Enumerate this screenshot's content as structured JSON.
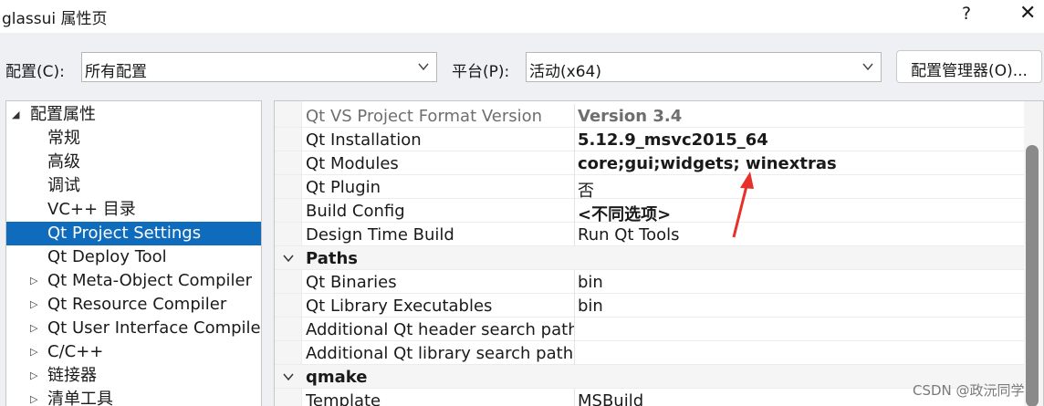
{
  "window": {
    "title": "glassui 属性页",
    "help_label": "?",
    "close_label": "✕"
  },
  "config_bar": {
    "config_label": "配置(C):",
    "config_value": "所有配置",
    "platform_label": "平台(P):",
    "platform_value": "活动(x64)",
    "manager_button": "配置管理器(O)..."
  },
  "tree": {
    "items": [
      {
        "label": "配置属性",
        "twisty": "◢"
      },
      {
        "label": "常规"
      },
      {
        "label": "高级"
      },
      {
        "label": "调试"
      },
      {
        "label": "VC++ 目录"
      },
      {
        "label": "Qt Project Settings"
      },
      {
        "label": "Qt Deploy Tool"
      },
      {
        "label": "Qt Meta-Object Compiler",
        "twisty": "▷"
      },
      {
        "label": "Qt Resource Compiler",
        "twisty": "▷"
      },
      {
        "label": "Qt User Interface Compiler",
        "twisty": "▷"
      },
      {
        "label": "C/C++",
        "twisty": "▷"
      },
      {
        "label": "链接器",
        "twisty": "▷"
      },
      {
        "label": "清单工具",
        "twisty": "▷"
      }
    ],
    "selected_index": 5
  },
  "properties": {
    "rows": [
      {
        "name": "Qt VS Project Format Version",
        "value": "Version 3.4"
      },
      {
        "name": "Qt Installation",
        "value": "5.12.9_msvc2015_64"
      },
      {
        "name": "Qt Modules",
        "value": "core;gui;widgets; winextras"
      },
      {
        "name": "Qt Plugin",
        "value": "否"
      },
      {
        "name": "Build Config",
        "value": "<不同选项>"
      },
      {
        "name": "Design Time Build",
        "value": "Run Qt Tools"
      },
      {
        "name": "Paths"
      },
      {
        "name": "Qt Binaries",
        "value": "bin"
      },
      {
        "name": "Qt Library Executables",
        "value": "bin"
      },
      {
        "name": "Additional Qt header search paths",
        "value": ""
      },
      {
        "name": "Additional Qt library search paths",
        "value": ""
      },
      {
        "name": "qmake"
      },
      {
        "name": "Template",
        "value": "MSBuild"
      }
    ]
  },
  "annotation": {
    "color": "#e8302a"
  },
  "watermark": "CSDN @政沅同学",
  "colors": {
    "accent": "#0f6cbd",
    "background": "#eef0f4"
  }
}
